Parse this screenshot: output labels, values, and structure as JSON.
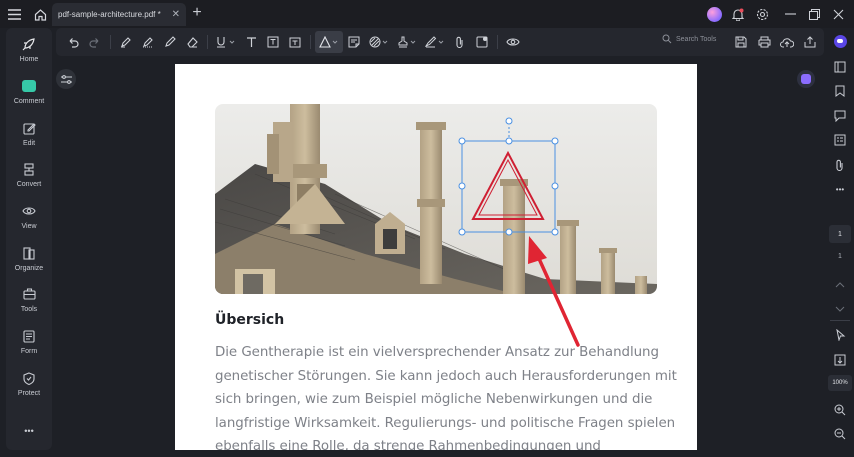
{
  "titlebar": {
    "tab_title": "pdf-sample-architecture.pdf *",
    "tab_close": "✕",
    "new_tab": "+"
  },
  "sidebar": {
    "items": [
      {
        "label": "Home",
        "icon": "rocket-icon"
      },
      {
        "label": "Comment",
        "icon": "comment-icon"
      },
      {
        "label": "Edit",
        "icon": "edit-icon"
      },
      {
        "label": "Convert",
        "icon": "convert-icon"
      },
      {
        "label": "View",
        "icon": "eye-icon"
      },
      {
        "label": "Organize",
        "icon": "organize-icon"
      },
      {
        "label": "Tools",
        "icon": "toolbox-icon"
      },
      {
        "label": "Form",
        "icon": "form-icon"
      },
      {
        "label": "Protect",
        "icon": "shield-icon"
      }
    ],
    "more": "•••"
  },
  "toolbar": {
    "search_placeholder": "Search Tools"
  },
  "rightbar": {
    "current_page": "1",
    "total_pages": "1",
    "zoom": "100%"
  },
  "document": {
    "heading": "Übersich",
    "paragraph_lines": [
      "Die Gentherapie ist ein vielversprechender Ansatz zur Behandlung",
      "genetischer Störungen. Sie kann jedoch auch Herausforderungen mit",
      "sich bringen, wie zum Beispiel mögliche Nebenwirkungen und die",
      "langfristige Wirksamkeit. Regulierungs- und politische Fragen spielen",
      "ebenfalls eine Rolle, da strenge Rahmenbedingungen und"
    ]
  },
  "colors": {
    "accent_red": "#e02533",
    "selection_blue": "#4a90e2",
    "comment_green": "#36c9a8"
  }
}
